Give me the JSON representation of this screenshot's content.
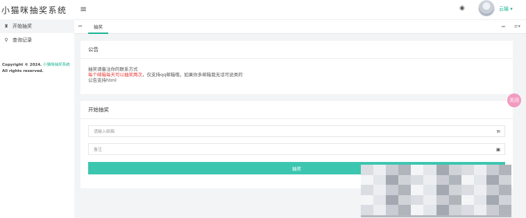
{
  "app": {
    "logo_text": "小猫咪抽奖系统",
    "username": "云猫 ▾",
    "accent_color": "#1ab394"
  },
  "sidebar": {
    "items": [
      {
        "icon": "home-icon",
        "label": "开始抽奖"
      },
      {
        "icon": "search-icon",
        "label": "查询记录"
      }
    ],
    "copyright_prefix": "Copyright © 2024. ",
    "copyright_link": "小猫咪抽奖系统",
    "copyright_suffix": " All rights reserved."
  },
  "topbar": {
    "menu_icon": "hamburger-icon",
    "theme_icon": "palette-icon"
  },
  "tabs": {
    "items": [
      {
        "label": "抽奖"
      }
    ]
  },
  "notice": {
    "title": "公告",
    "line1": "抽奖请备注你的联系方式",
    "line2_red": "每个邮箱每天可以抽奖两次",
    "line2_rest": "，仅支持qq邮箱哦，如果你多邮箱我无话可说类的",
    "line3": "公告支持html"
  },
  "lottery": {
    "title": "开始抽奖",
    "email_placeholder": "请输入邮箱",
    "email_icon": "envelope-icon",
    "remark_placeholder": "备注",
    "remark_icon": "note-icon",
    "submit_label": "抽奖",
    "button_color": "#3cc6b0"
  },
  "float_button": {
    "label": "关闭",
    "color": "#f29bc0"
  }
}
